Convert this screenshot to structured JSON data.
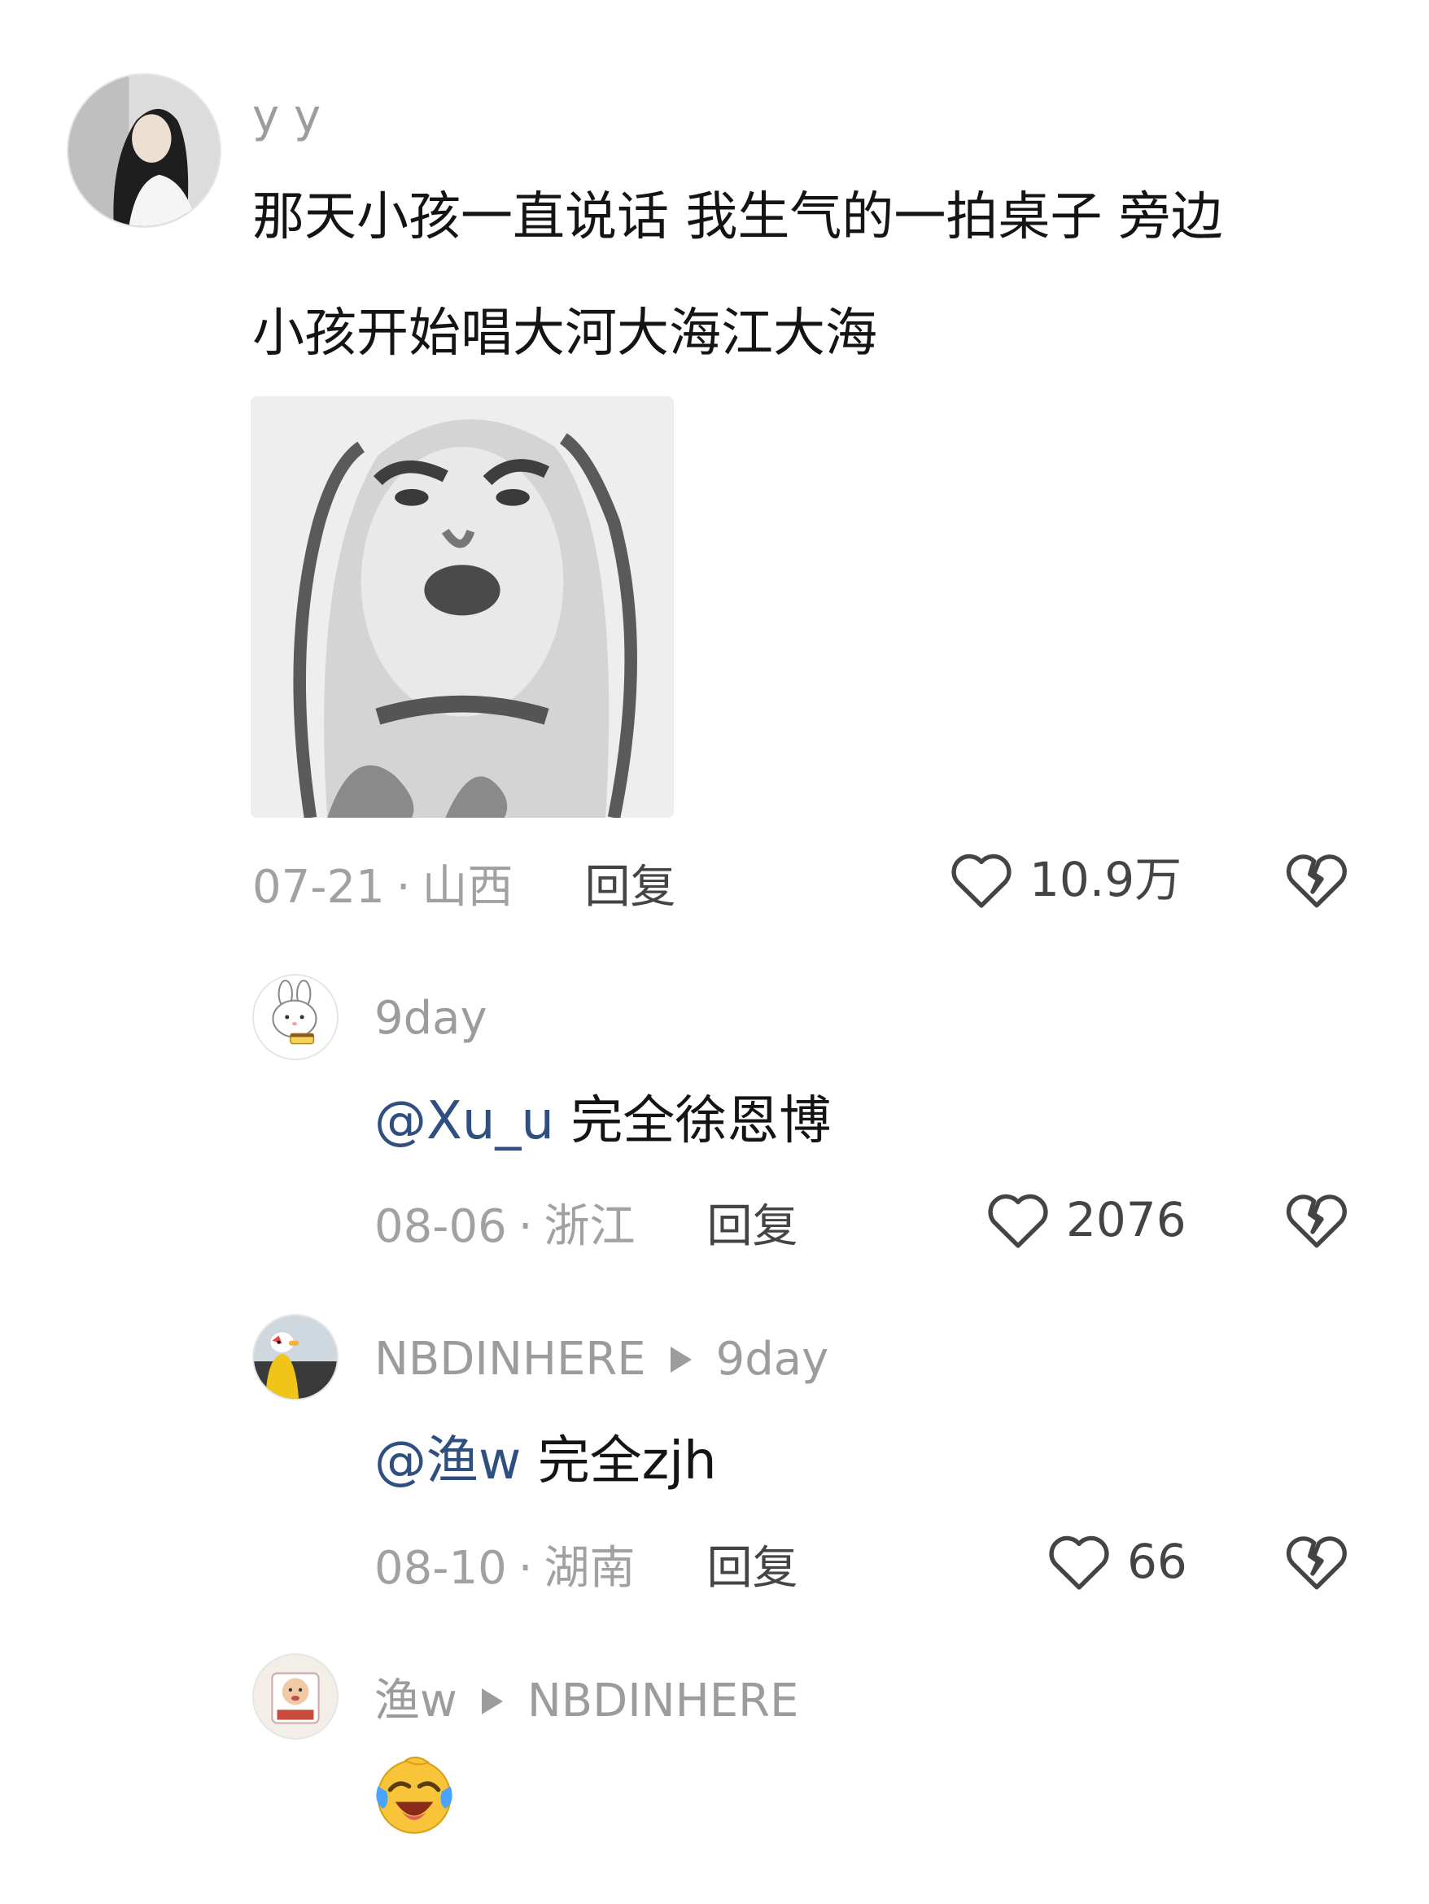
{
  "comments": [
    {
      "username": "y y",
      "text_line1": "那天小孩一直说话 我生气的一拍桌子 旁边",
      "text_line2": "小孩开始唱大河大海江大海",
      "date": "07-21",
      "location": "山西",
      "reply_label": "回复",
      "likes": "10.9万",
      "avatar_icon": "girl-portrait-avatar",
      "image_icon": "meme-face-image"
    },
    {
      "username": "9day",
      "mention": "@Xu_u",
      "text": "完全徐恩博",
      "date": "08-06",
      "location": "浙江",
      "reply_label": "回复",
      "likes": "2076",
      "avatar_icon": "bunny-avatar"
    },
    {
      "username": "NBDINHERE",
      "reply_to": "9day",
      "mention": "@渔w",
      "text": "完全zjh",
      "date": "08-10",
      "location": "湖南",
      "reply_label": "回复",
      "likes": "66",
      "avatar_icon": "duck-cartoon-avatar"
    },
    {
      "username": "渔w",
      "reply_to": "NBDINHERE",
      "emoji_icon": "laughing-crying-emoji",
      "avatar_icon": "baby-photo-avatar"
    }
  ],
  "separator": "·",
  "icons": {
    "like": "heart-outline-icon",
    "dislike": "broken-heart-icon",
    "reply_arrow": "play-triangle-icon"
  },
  "colors": {
    "text": "#141414",
    "meta": "#a1a1a1",
    "mention": "#2e4f7f",
    "icon": "#444444"
  }
}
